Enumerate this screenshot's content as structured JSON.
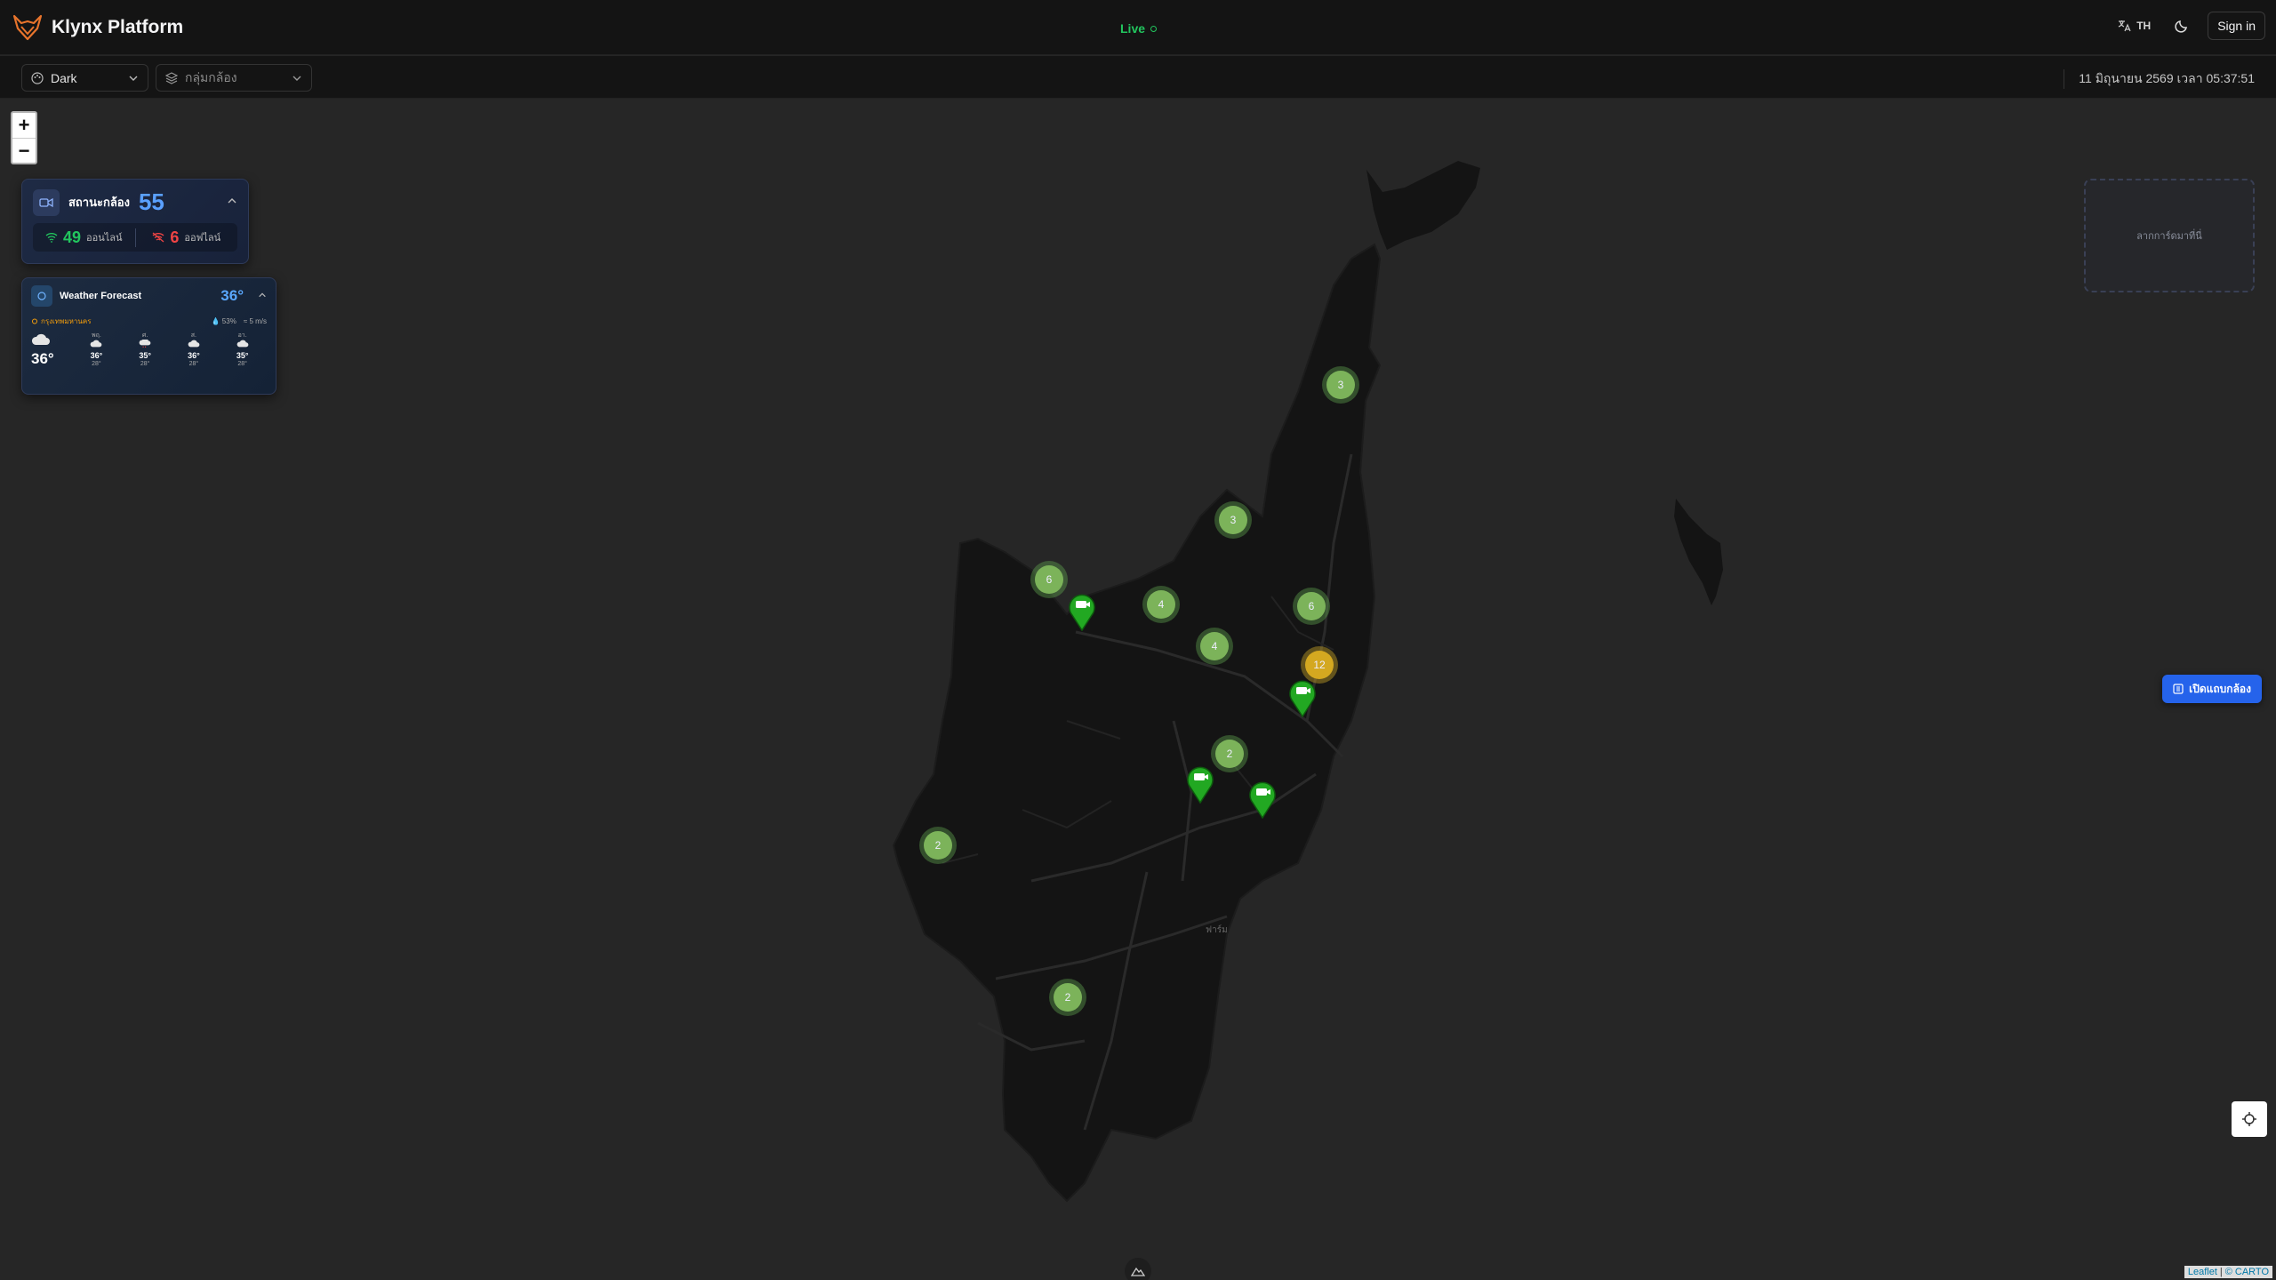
{
  "header": {
    "brand": "Klynx Platform",
    "live_label": "Live",
    "lang_label": "TH",
    "signin_label": "Sign in"
  },
  "toolbar": {
    "theme_select": "Dark",
    "group_select_placeholder": "กลุ่มกล้อง",
    "datetime": "11 มิถุนายน 2569 เวลา 05:37:51"
  },
  "camera_status": {
    "title": "สถานะกล้อง",
    "total": "55",
    "online_count": "49",
    "online_label": "ออนไลน์",
    "offline_count": "6",
    "offline_label": "ออฟไลน์"
  },
  "weather": {
    "title": "Weather Forecast",
    "current_temp": "36°",
    "location": "กรุงเทพมหานคร",
    "humidity": "53%",
    "wind": "5 m/s",
    "now_temp": "36°",
    "days": [
      {
        "day": "พฤ.",
        "hi": "36°",
        "lo": "28°"
      },
      {
        "day": "ศ.",
        "hi": "35°",
        "lo": "28°"
      },
      {
        "day": "ส.",
        "hi": "36°",
        "lo": "28°"
      },
      {
        "day": "อา.",
        "hi": "35°",
        "lo": "28°"
      }
    ]
  },
  "dropzone_label": "ลากการ์ดมาที่นี่",
  "open_cameras_label": "เปิดแถบกล้อง",
  "map": {
    "place_label": "ฟาร์ม",
    "clusters": [
      "3",
      "3",
      "6",
      "4",
      "6",
      "4",
      "12",
      "2",
      "2",
      "2"
    ],
    "attribution": {
      "leaflet": "Leaflet",
      "sep": "|",
      "carto": "© CARTO"
    }
  },
  "colors": {
    "accent": "#2563eb",
    "online": "#22c55e",
    "offline": "#ef4444",
    "cluster": "#7cb35a",
    "cluster_warn": "#d4a820"
  }
}
